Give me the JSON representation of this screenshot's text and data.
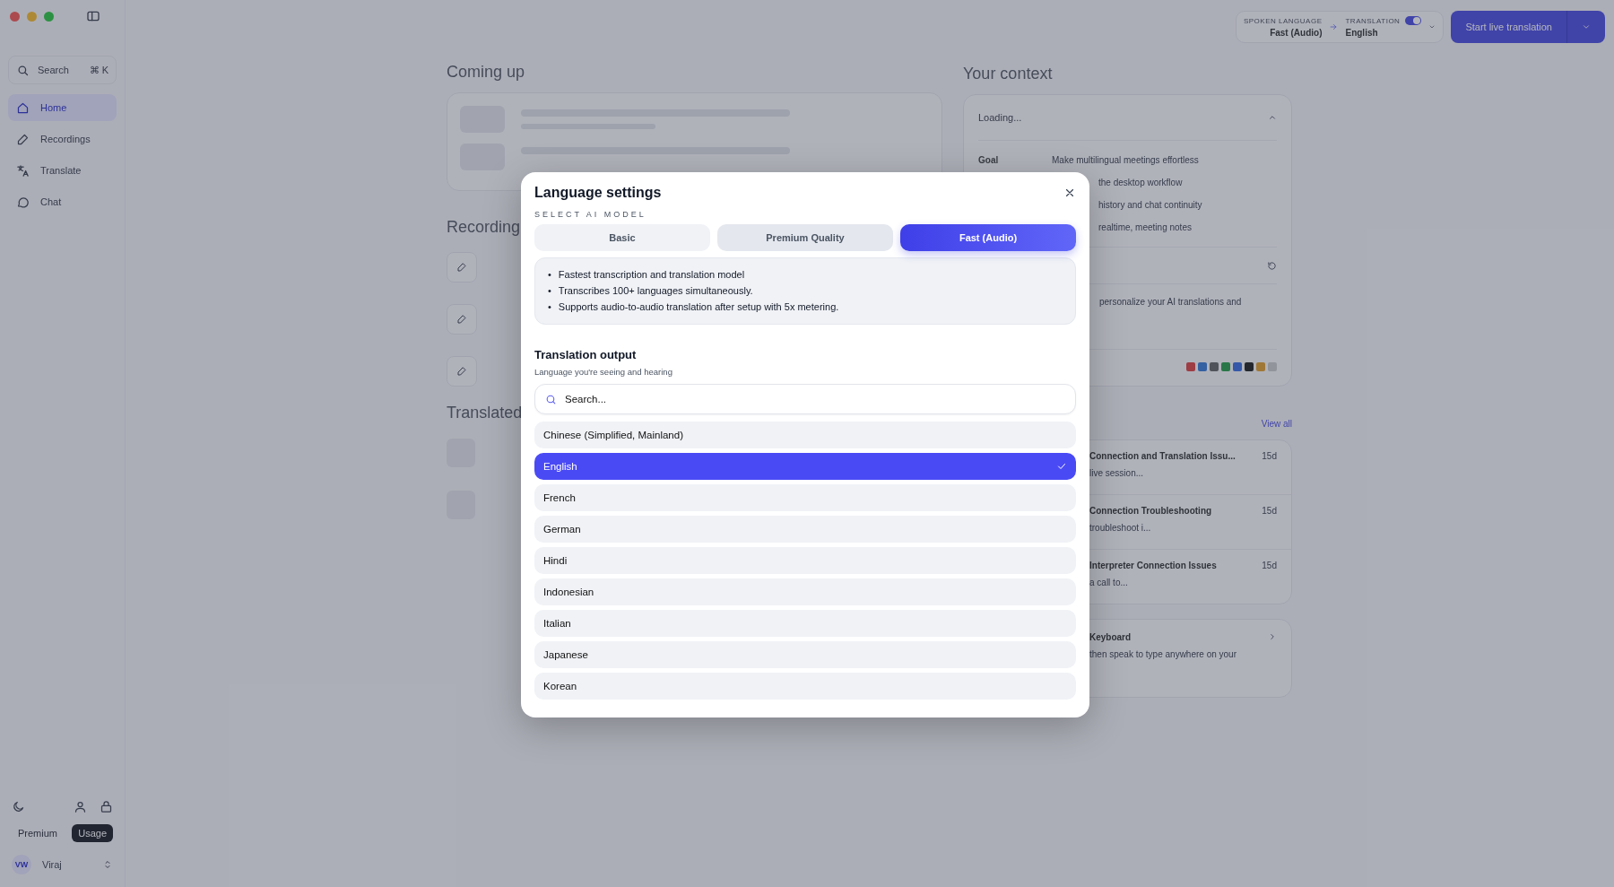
{
  "sidebar": {
    "search": {
      "placeholder": "Search",
      "shortcut": "⌘ K"
    },
    "items": [
      {
        "label": "Home",
        "selected": true
      },
      {
        "label": "Recordings",
        "selected": false
      },
      {
        "label": "Translate",
        "selected": false
      },
      {
        "label": "Chat",
        "selected": false
      }
    ],
    "plan_tabs": [
      {
        "label": "Premium",
        "selected": false
      },
      {
        "label": "Usage",
        "selected": true
      }
    ],
    "user": {
      "initials": "VW",
      "name": "Viraj"
    }
  },
  "top_bar": {
    "spoken_language": {
      "label": "SPOKEN LANGUAGE",
      "value": "Fast (Audio)"
    },
    "translation": {
      "label": "TRANSLATION",
      "value": "English",
      "on": true
    },
    "start_button": "Start live translation"
  },
  "main": {
    "coming_up": {
      "title": "Coming up"
    },
    "recordings": {
      "title": "Recording"
    },
    "translated": {
      "title": "Translated"
    },
    "context": {
      "title": "Your context",
      "status": "Loading...",
      "goal_label": "Goal",
      "lines": [
        "Make multilingual meetings effortless",
        "the desktop workflow",
        "history and chat continuity",
        "realtime, meeting notes"
      ],
      "note": "personalize your AI translations and"
    },
    "chats": {
      "view_all": "View all",
      "items": [
        {
          "title": "Connection and Translation Issu...",
          "preview": "live session...",
          "time": "15d"
        },
        {
          "title": "Connection Troubleshooting",
          "preview": "troubleshoot i...",
          "time": "15d"
        },
        {
          "title": "Interpreter Connection Issues",
          "preview": "a call to...",
          "time": "15d"
        }
      ]
    },
    "keyboard": {
      "title": "Keyboard",
      "text": "then speak to type anywhere on your"
    }
  },
  "modal": {
    "title": "Language settings",
    "section_label": "SELECT AI MODEL",
    "models": [
      {
        "label": "Basic",
        "selected": false
      },
      {
        "label": "Premium Quality",
        "selected": false
      },
      {
        "label": "Fast (Audio)",
        "selected": true
      }
    ],
    "bullet": "•",
    "features": [
      "Fastest transcription and translation model",
      "Transcribes 100+ languages simultaneously.",
      "Supports audio-to-audio translation after setup with 5x metering."
    ],
    "output": {
      "title": "Translation output",
      "subtitle": "Language you're seeing and hearing",
      "placeholder": "Search...",
      "languages": [
        {
          "name": "Chinese (Simplified, Mainland)",
          "selected": false
        },
        {
          "name": "English",
          "selected": true
        },
        {
          "name": "French",
          "selected": false
        },
        {
          "name": "German",
          "selected": false
        },
        {
          "name": "Hindi",
          "selected": false
        },
        {
          "name": "Indonesian",
          "selected": false
        },
        {
          "name": "Italian",
          "selected": false
        },
        {
          "name": "Japanese",
          "selected": false
        },
        {
          "name": "Korean",
          "selected": false
        }
      ]
    }
  }
}
